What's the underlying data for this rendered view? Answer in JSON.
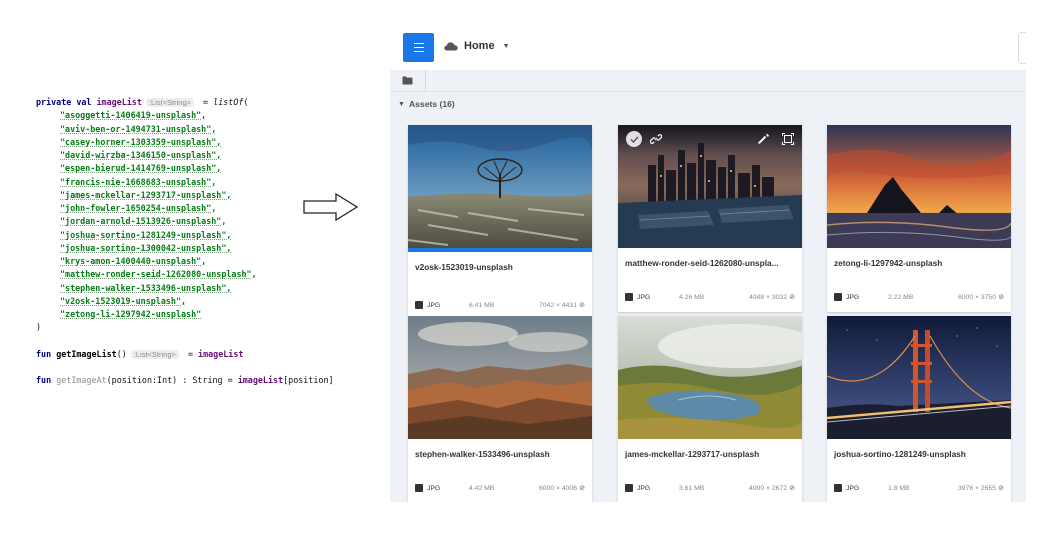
{
  "code": {
    "decl_keyword": "private val",
    "decl_name": "imageList",
    "decl_hint": ":List<String>",
    "decl_assign": " = ",
    "decl_call": "listOf",
    "decl_open": "(",
    "items": [
      "\"asoggetti-1406419-unsplash\",",
      "\"aviv-ben-or-1494731-unsplash\",",
      "\"casey-horner-1303359-unsplash\",",
      "\"david-wirzba-1346150-unsplash\",",
      "\"espen-bierud-1414769-unsplash\",",
      "\"francis-nie-1668683-unsplash\",",
      "\"james-mckellar-1293717-unsplash\",",
      "\"john-fowler-1650254-unsplash\",",
      "\"jordan-arnold-1513926-unsplash\",",
      "\"joshua-sortino-1281249-unsplash\",",
      "\"joshua-sortino-1300042-unsplash\",",
      "\"krys-amon-1400440-unsplash\",",
      "\"matthew-ronder-seid-1262080-unsplash\",",
      "\"stephen-walker-1533496-unsplash\",",
      "\"v2osk-1523019-unsplash\",",
      "\"zetong-li-1297942-unsplash\""
    ],
    "close": ")",
    "fn1_keyword": "fun",
    "fn1_name": "getImageList",
    "fn1_parens": "()",
    "fn1_hint": ":List<String>",
    "fn1_assign": " = ",
    "fn1_value": "imageList",
    "fn2_keyword": "fun",
    "fn2_name": "getImageAt",
    "fn2_params": "(position:Int) : String = ",
    "fn2_value": "imageList",
    "fn2_index": "[position]"
  },
  "header": {
    "location_label": "Home",
    "menu_icon": "hamburger-menu-icon",
    "location_icon": "cloud-icon"
  },
  "assets_section": {
    "label": "Assets (16)"
  },
  "colors": {
    "accent": "#1a78e6",
    "panel_bg": "#eef2f6"
  },
  "assets": [
    {
      "title": "v2osk-1523019-unsplash",
      "format": "JPG",
      "size": "6.41 MB",
      "dimensions": "7042 × 4431",
      "selected": true
    },
    {
      "title": "matthew-ronder-seid-1262080-unspla...",
      "format": "JPG",
      "size": "4.26 MB",
      "dimensions": "4048 × 3032",
      "hovered": true
    },
    {
      "title": "zetong-li-1297942-unsplash",
      "format": "JPG",
      "size": "2.22 MB",
      "dimensions": "6000 × 3750"
    },
    {
      "title": "stephen-walker-1533496-unsplash",
      "format": "JPG",
      "size": "4.42 MB",
      "dimensions": "6000 × 4006"
    },
    {
      "title": "james-mckellar-1293717-unsplash",
      "format": "JPG",
      "size": "3.61 MB",
      "dimensions": "4000 × 2672"
    },
    {
      "title": "joshua-sortino-1281249-unsplash",
      "format": "JPG",
      "size": "1.8 MB",
      "dimensions": "3976 × 2655"
    }
  ]
}
